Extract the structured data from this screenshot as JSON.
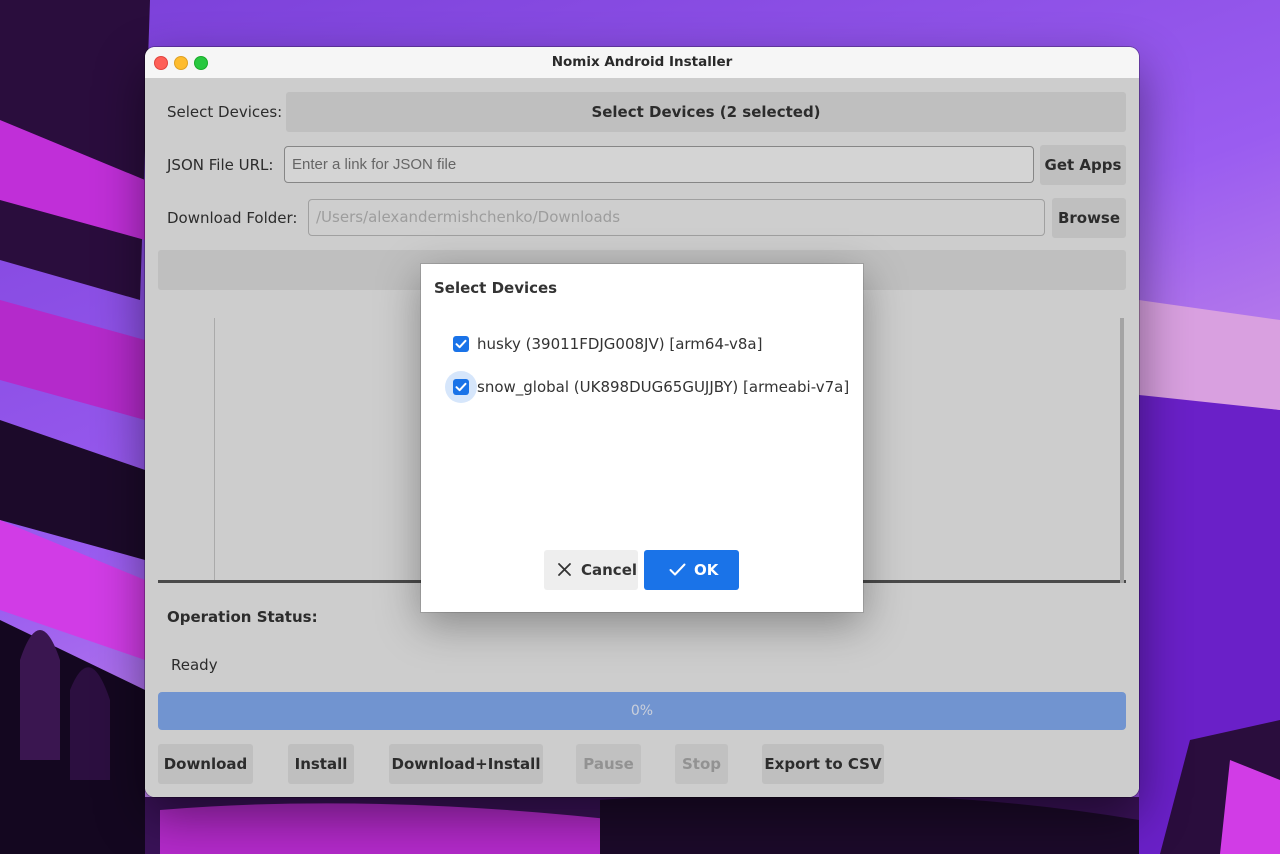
{
  "window": {
    "title": "Nomix Android Installer"
  },
  "form": {
    "select_devices_label": "Select Devices:",
    "select_devices_button": "Select Devices (2 selected)",
    "json_url_label": "JSON File URL:",
    "json_url_placeholder": "Enter a link for JSON file",
    "get_apps_button": "Get Apps",
    "download_folder_label": "Download Folder:",
    "download_folder_value": "/Users/alexandermishchenko/Downloads",
    "browse_button": "Browse"
  },
  "status": {
    "label": "Operation Status:",
    "value": "Ready",
    "progress_text": "0%",
    "progress_fraction": 0
  },
  "actions": {
    "download": "Download",
    "install": "Install",
    "download_install": "Download+Install",
    "pause": "Pause",
    "stop": "Stop",
    "export_csv": "Export to CSV"
  },
  "dialog": {
    "title": "Select Devices",
    "devices": [
      {
        "label": "husky (39011FDJG008JV) [arm64-v8a]",
        "checked": true
      },
      {
        "label": "snow_global (UK898DUG65GUJJBY) [armeabi-v7a]",
        "checked": true
      }
    ],
    "cancel": "Cancel",
    "ok": "OK"
  },
  "colors": {
    "accent": "#1a73e8",
    "progress": "#82abef"
  }
}
